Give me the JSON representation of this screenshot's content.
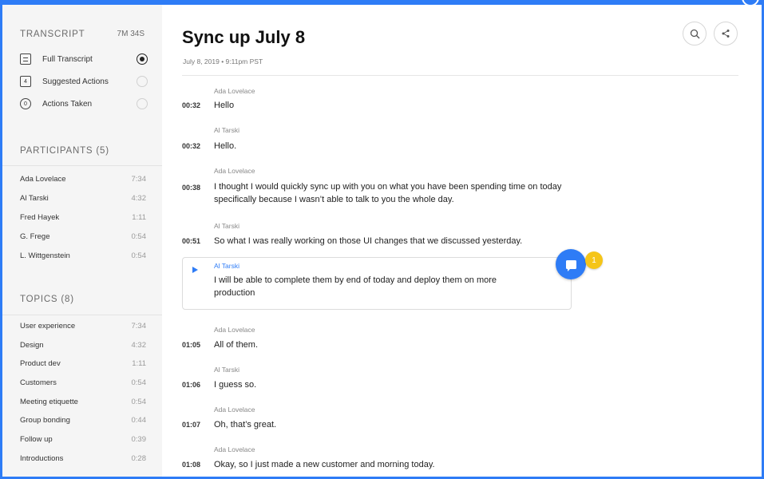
{
  "colors": {
    "accent": "#2e7cf6",
    "badge": "#f5c518",
    "sidebar_bg": "#f5f5f5"
  },
  "sidebar": {
    "transcript_heading": "TRANSCRIPT",
    "transcript_duration": "7M 34S",
    "transcript_options": [
      {
        "label": "Full Transcript",
        "icon": "document-icon",
        "icon_text": "",
        "selected": true
      },
      {
        "label": "Suggested Actions",
        "icon": "comment-count-icon",
        "icon_text": "4",
        "selected": false
      },
      {
        "label": "Actions Taken",
        "icon": "circle-count-icon",
        "icon_text": "0",
        "selected": false
      }
    ],
    "participants_heading": "PARTICIPANTS (5)",
    "participants": [
      {
        "name": "Ada Lovelace",
        "time": "7:34"
      },
      {
        "name": "Al Tarski",
        "time": "4:32"
      },
      {
        "name": "Fred Hayek",
        "time": "1:11"
      },
      {
        "name": "G. Frege",
        "time": "0:54"
      },
      {
        "name": "L. Wittgenstein",
        "time": "0:54"
      }
    ],
    "topics_heading": "TOPICS (8)",
    "topics": [
      {
        "name": "User experience",
        "time": "7:34"
      },
      {
        "name": "Design",
        "time": "4:32"
      },
      {
        "name": "Product dev",
        "time": "1:11"
      },
      {
        "name": "Customers",
        "time": "0:54"
      },
      {
        "name": "Meeting etiquette",
        "time": "0:54"
      },
      {
        "name": "Group bonding",
        "time": "0:44"
      },
      {
        "name": "Follow up",
        "time": "0:39"
      },
      {
        "name": "Introductions",
        "time": "0:28"
      }
    ]
  },
  "main": {
    "title": "Sync up July 8",
    "subtitle": "July 8, 2019 • 9:11pm PST",
    "search_icon": "search-icon",
    "share_icon": "share-icon",
    "entries": [
      {
        "speaker": "Ada Lovelace",
        "time": "00:32",
        "text": "Hello"
      },
      {
        "speaker": "Al Tarski",
        "time": "00:32",
        "text": "Hello."
      },
      {
        "speaker": "Ada Lovelace",
        "time": "00:38",
        "text": "I thought I would quickly sync up with you on what you have been spending time on today specifically because I wasn’t able to talk to you the whole day."
      },
      {
        "speaker": "Al Tarski",
        "time": "00:51",
        "text": "So what I was really working on those UI changes that we discussed yesterday."
      },
      {
        "speaker": "Ada Lovelace",
        "time": "01:05",
        "text": "All of them."
      },
      {
        "speaker": "Al Tarski",
        "time": "01:06",
        "text": "I guess so."
      },
      {
        "speaker": "Ada Lovelace",
        "time": "01:07",
        "text": "Oh, that’s great."
      },
      {
        "speaker": "Ada Lovelace",
        "time": "01:08",
        "text": "Okay, so I just made a new customer and morning today."
      }
    ],
    "highlighted": {
      "speaker": "Al Tarski",
      "text": "I will be able to complete them by end of today and deploy them on more production"
    },
    "comment_badge": "1"
  }
}
